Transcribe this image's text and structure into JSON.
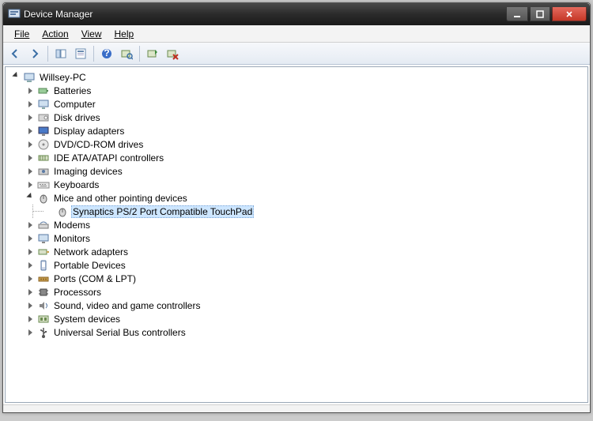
{
  "window": {
    "title": "Device Manager"
  },
  "menu": {
    "file": "File",
    "action": "Action",
    "view": "View",
    "help": "Help"
  },
  "tree": {
    "root": "Willsey-PC",
    "cats": [
      {
        "label": "Batteries",
        "icon": "battery"
      },
      {
        "label": "Computer",
        "icon": "computer"
      },
      {
        "label": "Disk drives",
        "icon": "disk"
      },
      {
        "label": "Display adapters",
        "icon": "display"
      },
      {
        "label": "DVD/CD-ROM drives",
        "icon": "optical"
      },
      {
        "label": "IDE ATA/ATAPI controllers",
        "icon": "ide"
      },
      {
        "label": "Imaging devices",
        "icon": "imaging"
      },
      {
        "label": "Keyboards",
        "icon": "keyboard"
      },
      {
        "label": "Mice and other pointing devices",
        "icon": "mouse",
        "expanded": true,
        "children": [
          {
            "label": "Synaptics PS/2 Port Compatible TouchPad",
            "icon": "mouse",
            "selected": true
          }
        ]
      },
      {
        "label": "Modems",
        "icon": "modem"
      },
      {
        "label": "Monitors",
        "icon": "monitor"
      },
      {
        "label": "Network adapters",
        "icon": "network"
      },
      {
        "label": "Portable Devices",
        "icon": "portable"
      },
      {
        "label": "Ports (COM & LPT)",
        "icon": "port"
      },
      {
        "label": "Processors",
        "icon": "cpu"
      },
      {
        "label": "Sound, video and game controllers",
        "icon": "sound"
      },
      {
        "label": "System devices",
        "icon": "system"
      },
      {
        "label": "Universal Serial Bus controllers",
        "icon": "usb"
      }
    ]
  }
}
